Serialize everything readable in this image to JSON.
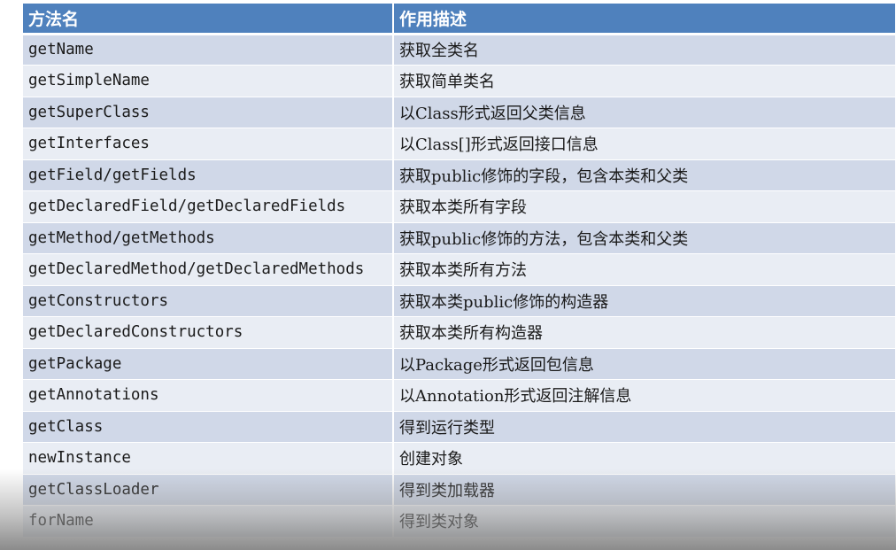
{
  "table": {
    "headers": [
      "方法名",
      "作用描述"
    ],
    "rows": [
      {
        "name": "getName",
        "desc": "获取全类名"
      },
      {
        "name": "getSimpleName",
        "desc": "获取简单类名"
      },
      {
        "name": "getSuperClass",
        "desc": "以Class形式返回父类信息"
      },
      {
        "name": "getInterfaces",
        "desc": "以Class[]形式返回接口信息"
      },
      {
        "name": "getField/getFields",
        "desc": "获取public修饰的字段，包含本类和父类"
      },
      {
        "name": "getDeclaredField/getDeclaredFields",
        "desc": "获取本类所有字段"
      },
      {
        "name": "getMethod/getMethods",
        "desc": "获取public修饰的方法，包含本类和父类"
      },
      {
        "name": "getDeclaredMethod/getDeclaredMethods",
        "desc": "获取本类所有方法"
      },
      {
        "name": "getConstructors",
        "desc": "获取本类public修饰的构造器"
      },
      {
        "name": "getDeclaredConstructors",
        "desc": "获取本类所有构造器"
      },
      {
        "name": "getPackage",
        "desc": "以Package形式返回包信息"
      },
      {
        "name": "getAnnotations",
        "desc": "以Annotation形式返回注解信息"
      },
      {
        "name": "getClass",
        "desc": "得到运行类型"
      },
      {
        "name": "newInstance",
        "desc": "创建对象"
      },
      {
        "name": "getClassLoader",
        "desc": "得到类加载器"
      },
      {
        "name": "forName",
        "desc": "得到类对象"
      }
    ]
  },
  "colors": {
    "header_bg": "#4f81bd",
    "row_odd_bg": "#d0d8e8",
    "row_even_bg": "#e9edf4",
    "header_text": "#ffffff"
  }
}
